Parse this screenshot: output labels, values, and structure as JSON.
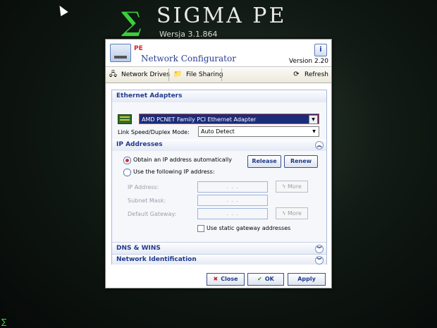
{
  "desktop": {
    "brand": "SIGMA PE",
    "sigma_glyph": "∑",
    "version_line": "Wersja 3.1.864"
  },
  "window": {
    "pe_label": "PE",
    "title": "Network Configurator",
    "version": "Version 2.20",
    "info_glyph": "i"
  },
  "toolbar": {
    "network_drives": "Network Drives",
    "file_sharing": "File Sharing",
    "refresh": "Refresh"
  },
  "ethernet": {
    "heading": "Ethernet Adapters",
    "adapter": "AMD PCNET Family PCI Ethernet Adapter",
    "link_label": "Link Speed/Duplex Mode:",
    "link_value": "Auto Detect"
  },
  "ip": {
    "heading": "IP Addresses",
    "auto_label": "Obtain an IP address automatically",
    "manual_label": "Use the following IP address:",
    "release": "Release",
    "renew": "Renew",
    "ip_address_label": "IP Address:",
    "subnet_label": "Subnet Mask:",
    "gateway_label": "Default Gateway:",
    "ip_value": ".     .     .",
    "subnet_value": ".     .     .",
    "gateway_value": ".     .     .",
    "more": "More",
    "static_gateway": "Use static gateway addresses"
  },
  "sections": {
    "dns": "DNS & WINS",
    "netid": "Network Identification"
  },
  "footer": {
    "close": "Close",
    "ok": "OK",
    "apply": "Apply"
  }
}
